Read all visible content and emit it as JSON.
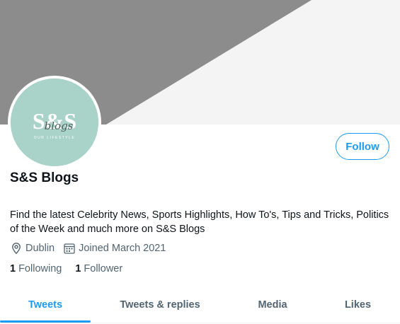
{
  "profile": {
    "display_name": "S&S Blogs",
    "avatar_text": "S&S",
    "avatar_script": "blogs",
    "avatar_tagline": "OUR LIFESTYLE",
    "bio": "Find the latest Celebrity News, Sports Highlights, How To's, Tips and Tricks, Politics of the Week and much more on S&S Blogs",
    "location": "Dublin",
    "joined": "Joined March 2021",
    "follow_label": "Follow"
  },
  "stats": {
    "following_count": "1",
    "following_label": "Following",
    "followers_count": "1",
    "followers_label": "Follower"
  },
  "tabs": [
    {
      "label": "Tweets",
      "active": true
    },
    {
      "label": "Tweets & replies",
      "active": false
    },
    {
      "label": "Media",
      "active": false
    },
    {
      "label": "Likes",
      "active": false
    }
  ],
  "icons": {
    "location": "location-pin-icon",
    "joined": "calendar-icon"
  },
  "colors": {
    "accent": "#1d9bf0",
    "banner_dark": "#8c8c8c",
    "banner_light": "#f4f4f4",
    "avatar_bg": "#a9d3c9",
    "secondary_text": "#536471"
  }
}
